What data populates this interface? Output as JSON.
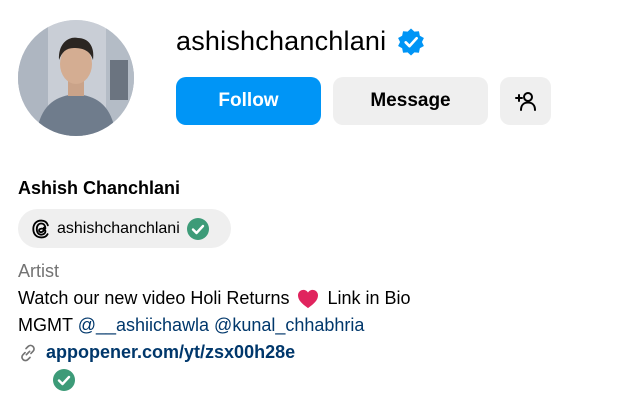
{
  "profile": {
    "username": "ashishchanchlani",
    "full_name": "Ashish Chanchlani",
    "category": "Artist",
    "verified": true
  },
  "actions": {
    "follow_label": "Follow",
    "message_label": "Message"
  },
  "threads": {
    "handle": "ashishchanchlani"
  },
  "bio": {
    "line1_before": "Watch our new video Holi Returns",
    "line1_after": "Link in Bio",
    "line2_prefix": "MGMT",
    "mention1": "@__ashiichawla",
    "mention2": "@kunal_chhabhria"
  },
  "link": {
    "text": "appopener.com/yt/zsx00h28e"
  },
  "icons": {
    "verified": "verified-badge-icon",
    "add_user": "add-user-icon",
    "threads": "threads-icon",
    "heart": "heart-icon",
    "link": "link-icon",
    "check": "check-icon"
  },
  "colors": {
    "accent": "#0095f6",
    "secondary_button": "#efefef",
    "link": "#00376b",
    "muted": "#737373",
    "check_green": "#3d9b78",
    "heart_red": "#e0245e"
  }
}
